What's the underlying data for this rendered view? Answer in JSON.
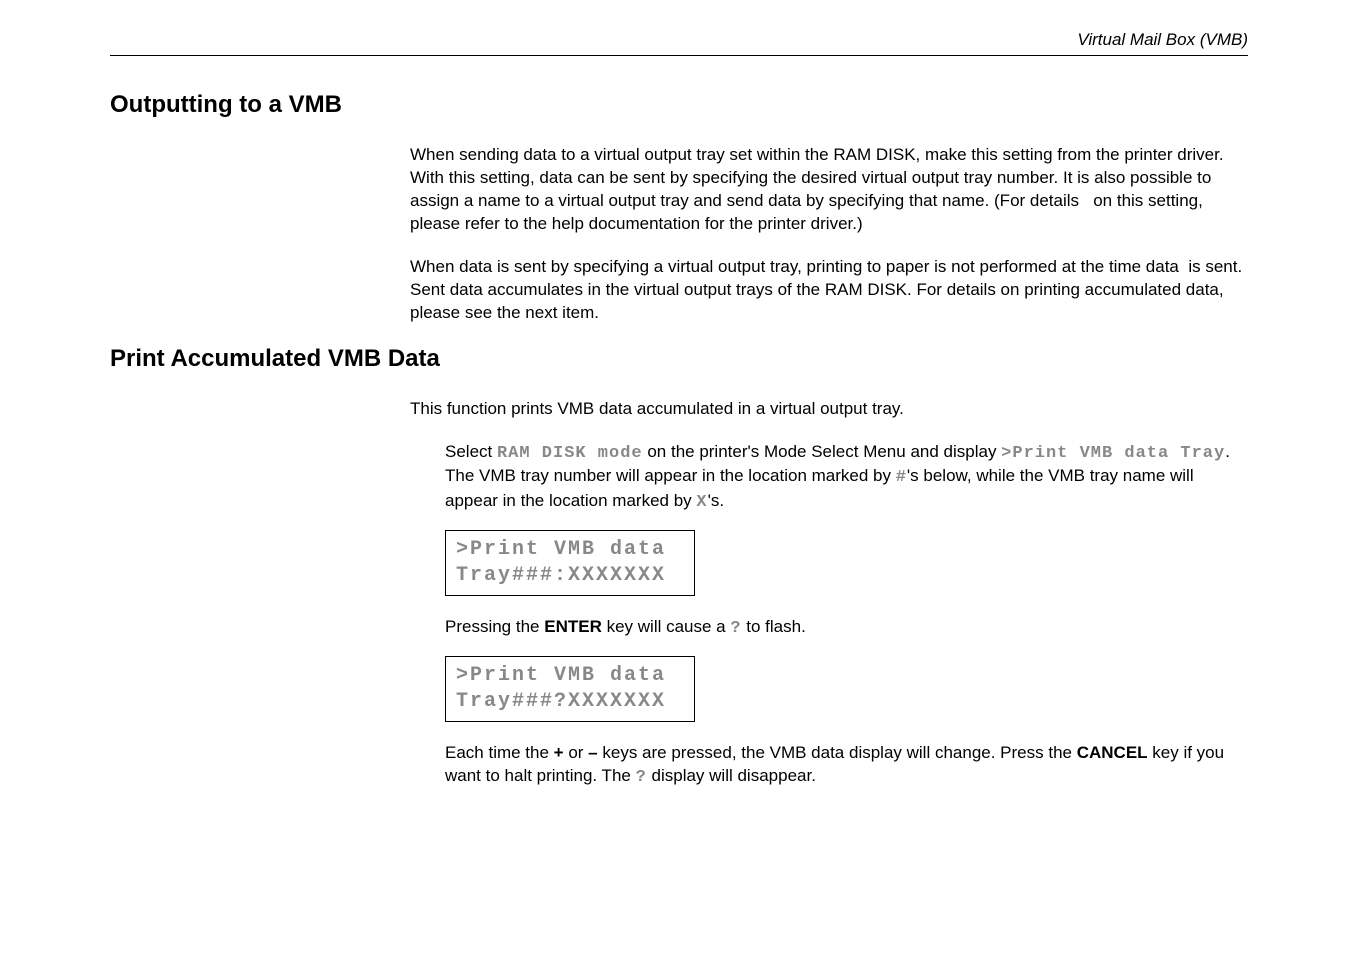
{
  "header": {
    "title": "Virtual Mail Box (VMB)"
  },
  "section1": {
    "heading": "Outputting to a VMB",
    "para1": "When sending data to a virtual output tray set within the RAM DISK, make this setting from the printer driver. With this setting, data can be sent by specifying the desired virtual output tray number. It is also possible to assign a name to a virtual output tray and send data by specifying that name. (For details   on this setting, please refer to the help documentation for the printer driver.)",
    "para2": "When data is sent by specifying a virtual output tray, printing to paper is not performed at the time data  is sent. Sent data accumulates in the virtual output trays of the RAM DISK. For details on printing accumulated data, please see the next item."
  },
  "section2": {
    "heading": "Print Accumulated VMB Data",
    "intro": "This function prints VMB data accumulated in a virtual output tray.",
    "step1_pre": "Select ",
    "step1_code1": "RAM DISK mode",
    "step1_mid1": " on the printer's Mode Select Menu and display ",
    "step1_code2": ">Print VMB data Tray",
    "step1_mid2": ". The VMB tray number will appear in the location marked by ",
    "step1_code3": "#",
    "step1_mid3": "'s below, while the VMB tray name will appear in the location marked by ",
    "step1_code4": "X",
    "step1_end": "'s.",
    "lcd1_line1": ">Print VMB data",
    "lcd1_line2": "Tray###:XXXXXXX",
    "step2_pre": "Pressing the ",
    "step2_bold": "ENTER",
    "step2_mid": " key will cause a ",
    "step2_code": "?",
    "step2_end": " to flash.",
    "lcd2_line1": ">Print VMB data",
    "lcd2_line2": "Tray###?XXXXXXX",
    "step3_pre": "Each time the ",
    "step3_bold1": "+",
    "step3_mid1": " or ",
    "step3_bold2": "–",
    "step3_mid2": " keys are pressed, the VMB data display will change. Press the ",
    "step3_bold3": "CANCEL",
    "step3_mid3": " key if you want to halt printing. The ",
    "step3_code": "?",
    "step3_end": " display will disappear."
  }
}
